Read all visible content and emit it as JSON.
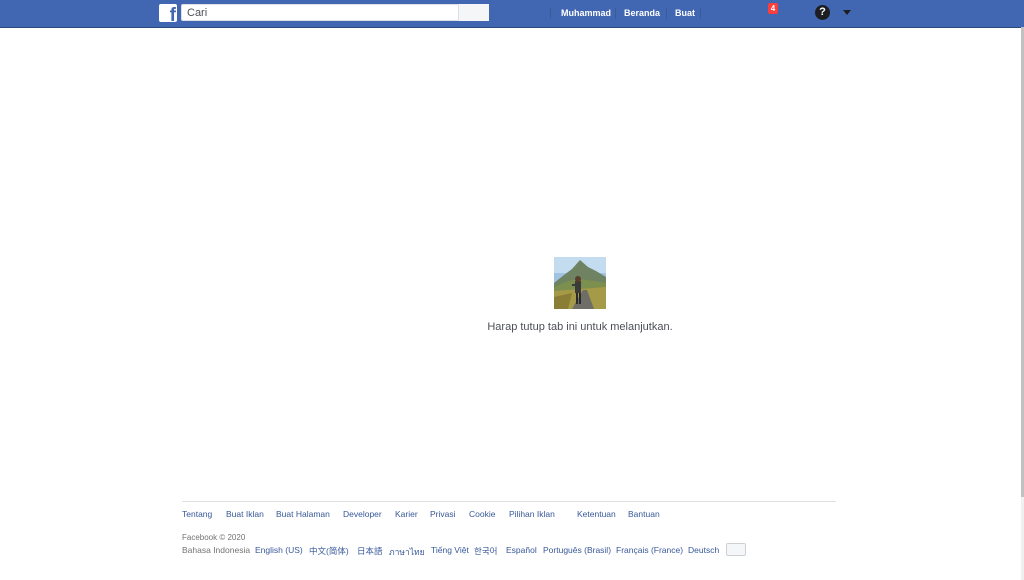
{
  "header": {
    "search": {
      "placeholder": "Cari",
      "value": ""
    },
    "nav": {
      "profile": "Muhammad",
      "home": "Beranda",
      "create": "Buat"
    },
    "notifications_count": "4",
    "help_glyph": "?"
  },
  "main": {
    "message": "Harap tutup tab ini untuk melanjutkan."
  },
  "footer": {
    "links": [
      "Tentang",
      "Buat Iklan",
      "Buat Halaman",
      "Developer",
      "Karier",
      "Privasi",
      "Cookie",
      "Pilihan Iklan",
      "Ketentuan",
      "Bantuan"
    ],
    "copyright": "Facebook © 2020",
    "current_language": "Bahasa Indonesia",
    "languages": [
      "English (US)",
      "中文(简体)",
      "日本語",
      "ภาษาไทย",
      "Tiếng Việt",
      "한국어",
      "Español",
      "Português (Brasil)",
      "Français (France)",
      "Deutsch"
    ]
  },
  "colors": {
    "brand": "#4267b2",
    "link": "#385898",
    "notification": "#fa3e3e"
  },
  "icons": [
    "facebook-logo-icon",
    "notification-badge",
    "help-icon",
    "caret-down-icon",
    "language-more-button"
  ]
}
